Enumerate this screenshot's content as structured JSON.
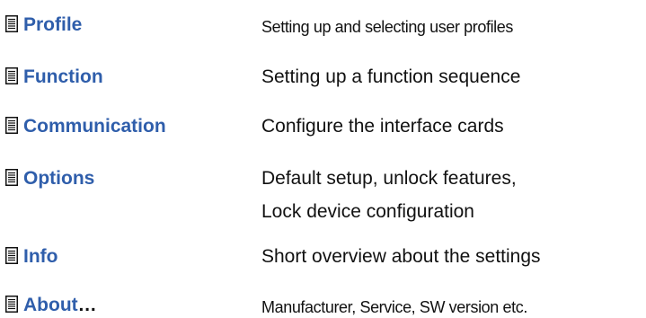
{
  "menu": {
    "items": [
      {
        "label": "Profile",
        "suffix": "",
        "description_lines": [
          "Setting up and selecting user profiles"
        ],
        "icon": "document-icon"
      },
      {
        "label": "Function",
        "suffix": "",
        "description_lines": [
          "Setting up a function sequence"
        ],
        "icon": "document-icon"
      },
      {
        "label": "Communication",
        "suffix": "",
        "description_lines": [
          "Configure the interface cards"
        ],
        "icon": "document-icon"
      },
      {
        "label": "Options",
        "suffix": "",
        "description_lines": [
          "Default setup, unlock features,",
          "Lock device configuration"
        ],
        "icon": "document-icon"
      },
      {
        "label": "Info",
        "suffix": "",
        "description_lines": [
          "Short overview about the settings"
        ],
        "icon": "document-icon"
      },
      {
        "label": "About",
        "suffix": "…",
        "description_lines": [
          "Manufacturer, Service, SW version etc."
        ],
        "icon": "document-icon"
      }
    ]
  },
  "colors": {
    "link": "#2f5eab",
    "text": "#111111",
    "background": "#ffffff"
  }
}
